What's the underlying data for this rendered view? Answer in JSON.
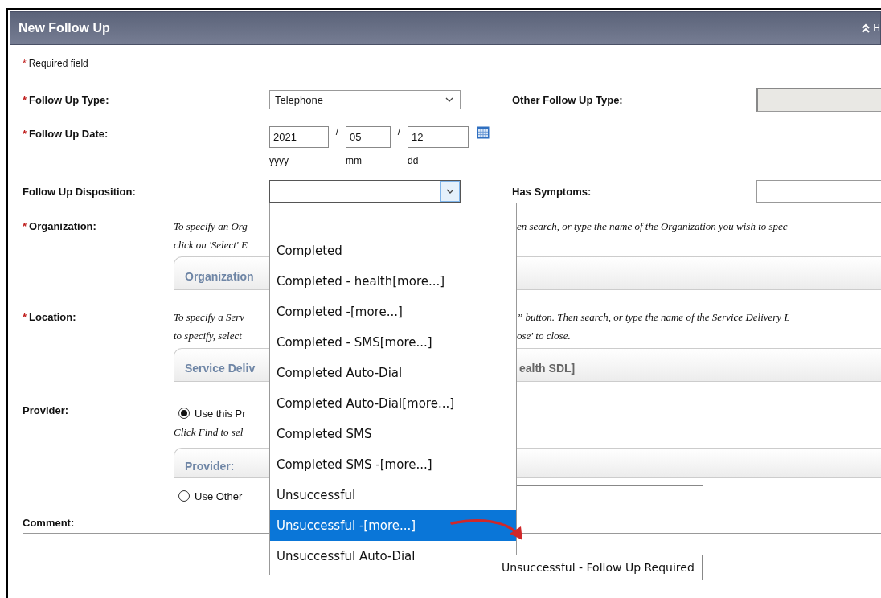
{
  "panel": {
    "title": "New Follow Up",
    "collapse_label": "H"
  },
  "required_note": {
    "marker": "*",
    "text": "Required field"
  },
  "follow_up_type": {
    "marker": "*",
    "label": "Follow Up Type:",
    "value": "Telephone"
  },
  "other_follow_up_type": {
    "label": "Other Follow Up Type:",
    "disabled": true
  },
  "follow_up_date": {
    "marker": "*",
    "label": "Follow Up Date:",
    "separators": [
      "/",
      "/"
    ],
    "parts": [
      {
        "value": "2021",
        "hint": "yyyy"
      },
      {
        "value": "05",
        "hint": "mm"
      },
      {
        "value": "12",
        "hint": "dd"
      }
    ]
  },
  "follow_up_disposition": {
    "label": "Follow Up Disposition:",
    "open": true,
    "options": [
      {
        "label": "Completed",
        "selected": false
      },
      {
        "label": "Completed - health[more...]",
        "selected": false
      },
      {
        "label": "Completed -[more...]",
        "selected": false
      },
      {
        "label": "Completed - SMS[more...]",
        "selected": false
      },
      {
        "label": "Completed Auto-Dial",
        "selected": false
      },
      {
        "label": "Completed Auto-Dial[more...]",
        "selected": false
      },
      {
        "label": "Completed SMS",
        "selected": false
      },
      {
        "label": "Completed SMS -[more...]",
        "selected": false
      },
      {
        "label": "Unsuccessful",
        "selected": false
      },
      {
        "label": "Unsuccessful -[more...]",
        "selected": true
      },
      {
        "label": "Unsuccessful Auto-Dial",
        "selected": false
      }
    ]
  },
  "has_symptoms": {
    "label": "Has Symptoms:"
  },
  "organization": {
    "marker": "*",
    "label": "Organization:",
    "hint_lines": [
      {
        "left": "To specify an Org",
        "right": "en search, or type the name of the Organization you wish to spec"
      },
      {
        "left": "click on 'Select' E"
      }
    ],
    "panel": {
      "left": "Organization"
    }
  },
  "location": {
    "marker": "*",
    "label": "Location:",
    "hint_lines": [
      {
        "left": "To specify a Serv",
        "right": "” button. Then search, or type the name of the Service Delivery L"
      },
      {
        "left": "to specify, select",
        "right": "ose' to close."
      }
    ],
    "panel": {
      "left": "Service Deliv",
      "right": "ealth SDL]"
    }
  },
  "provider": {
    "label": "Provider:",
    "note": "Click Find to sel",
    "panel": {
      "left": "Provider:"
    },
    "options": [
      {
        "label": "Use this Pr",
        "selected": true
      },
      {
        "label": "Use Other",
        "selected": false
      }
    ]
  },
  "comment": {
    "label": "Comment:"
  },
  "tooltip": {
    "text": "Unsuccessful - Follow Up Required"
  }
}
